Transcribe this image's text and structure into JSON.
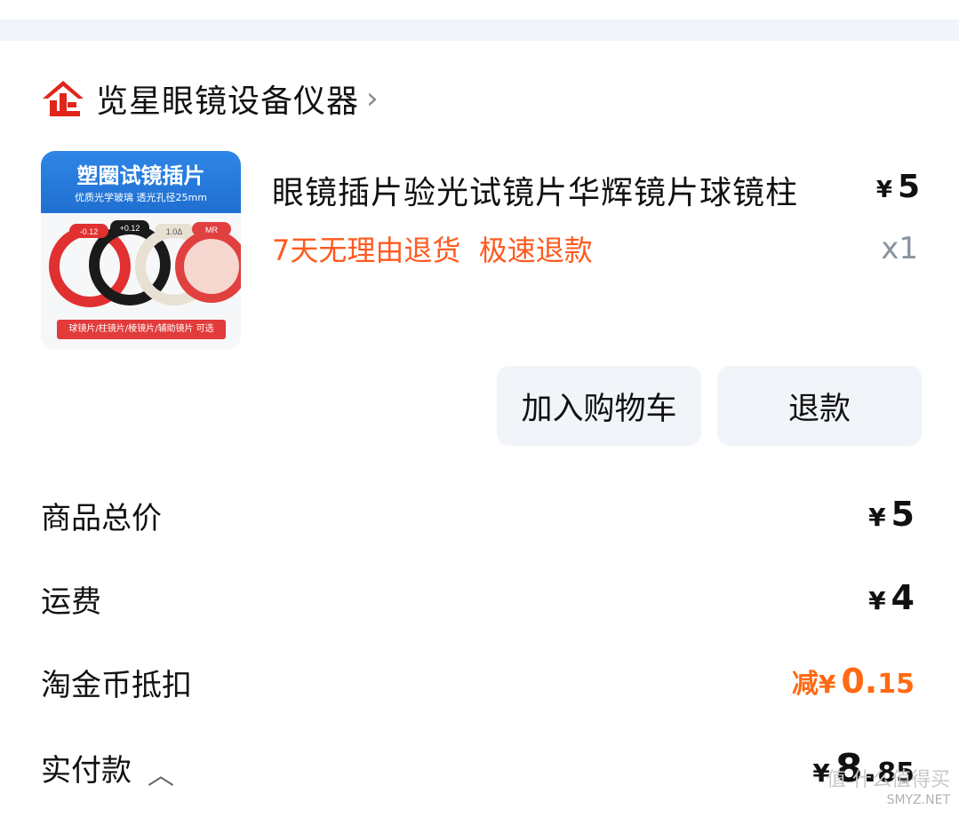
{
  "shop": {
    "name": "览星眼镜设备仪器"
  },
  "product": {
    "image": {
      "banner_title": "塑圈试镜插片",
      "banner_sub": "优质光学玻璃  透光孔径25mm",
      "lens_labels": [
        "-0.12",
        "+0.12",
        "1.0Δ",
        "MR"
      ],
      "footer": "球镜片/柱镜片/棱镜片/辅助镜片 可选"
    },
    "title": "眼镜插片验光试镜片华辉镜片球镜柱",
    "price_symbol": "¥",
    "price": "5",
    "promo": "7天无理由退货  极速退款",
    "quantity": "x1"
  },
  "actions": {
    "add_to_cart": "加入购物车",
    "refund": "退款"
  },
  "summary": {
    "subtotal_label": "商品总价",
    "subtotal_symbol": "¥",
    "subtotal": "5",
    "shipping_label": "运费",
    "shipping_symbol": "¥",
    "shipping": "4",
    "coin_label": "淘金币抵扣",
    "coin_prefix": "减",
    "coin_symbol": "¥",
    "coin_int": "0.",
    "coin_dec": "15",
    "paid_label": "实付款",
    "paid_symbol": "¥",
    "paid_int": "8.",
    "paid_dec": "85"
  },
  "watermark": {
    "text": "值 什么值得买",
    "sub": "SMYZ.NET"
  },
  "colors": {
    "accent_orange": "#ff6a13",
    "promo_orange": "#ff5a1f",
    "button_bg": "#f1f4f8",
    "logo_red": "#e1251b"
  }
}
